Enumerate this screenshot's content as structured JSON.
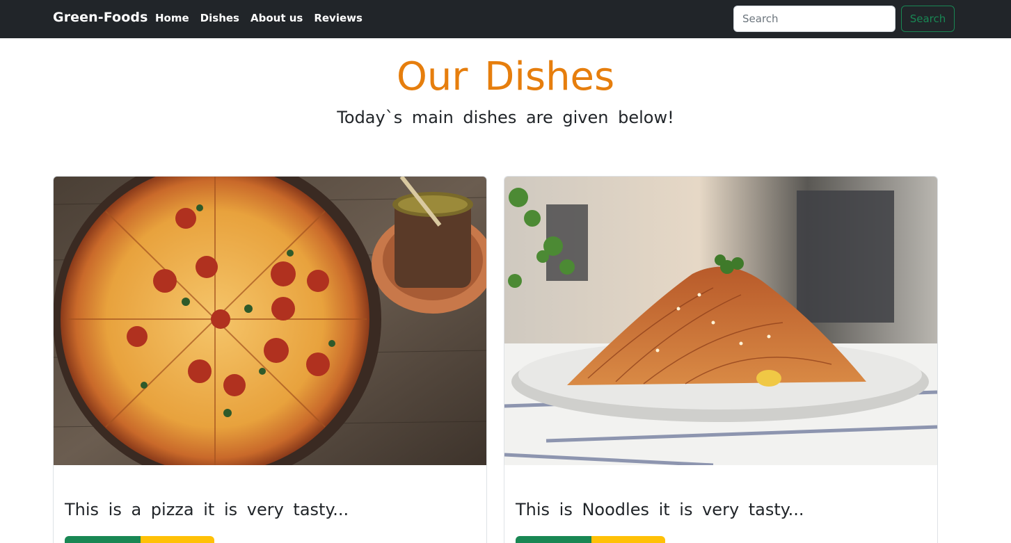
{
  "navbar": {
    "brand": "Green-Foods",
    "links": [
      "Home",
      "Dishes",
      "About us",
      "Reviews"
    ],
    "search_placeholder": "Search",
    "search_button": "Search"
  },
  "hero": {
    "title": "Our Dishes",
    "subtitle": "Today`s main dishes are given below!"
  },
  "cards": [
    {
      "image": "pizza-photo",
      "text": "This is a pizza it is very tasty..."
    },
    {
      "image": "noodles-photo",
      "text": "This is Noodles it is very tasty..."
    }
  ],
  "colors": {
    "navbar_bg": "#212529",
    "heading_orange": "#e67e0d",
    "success_green": "#198754",
    "warning_yellow": "#ffc107"
  }
}
